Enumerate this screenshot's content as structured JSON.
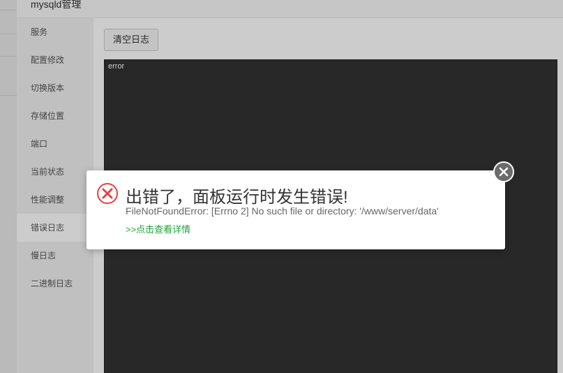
{
  "window": {
    "title": "mysqld管理"
  },
  "sidebar": {
    "items": [
      {
        "label": "服务"
      },
      {
        "label": "配置修改"
      },
      {
        "label": "切换版本"
      },
      {
        "label": "存储位置"
      },
      {
        "label": "端口"
      },
      {
        "label": "当前状态"
      },
      {
        "label": "性能调整"
      },
      {
        "label": "错误日志",
        "active": true
      },
      {
        "label": "慢日志"
      },
      {
        "label": "二进制日志"
      }
    ]
  },
  "content": {
    "clear_button": "清空日志",
    "log_text": "error"
  },
  "dialog": {
    "title": "出错了，面板运行时发生错误!",
    "message": "FileNotFoundError: [Errno 2] No such file or directory: '/www/server/data'",
    "link": ">>点击查看详情",
    "icon": "error-circle-icon",
    "close_icon": "close-icon"
  },
  "colors": {
    "accent": "#20a53a",
    "error": "#e64242",
    "log_bg": "#333333"
  }
}
